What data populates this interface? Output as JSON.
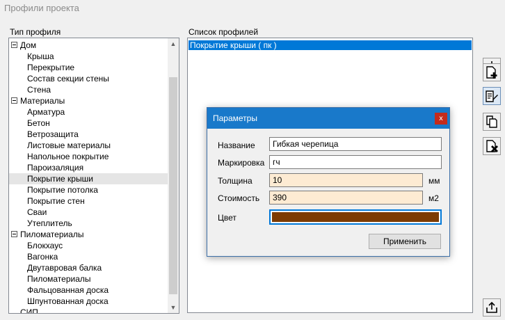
{
  "window": {
    "title": "Профили проекта"
  },
  "tree": {
    "label": "Тип профиля",
    "rows": [
      {
        "text": "Дом",
        "level": 0,
        "expandable": true
      },
      {
        "text": "Крыша",
        "level": 1
      },
      {
        "text": "Перекрытие",
        "level": 1
      },
      {
        "text": "Состав секции стены",
        "level": 1
      },
      {
        "text": "Стена",
        "level": 1
      },
      {
        "text": "Материалы",
        "level": 0,
        "expandable": true
      },
      {
        "text": "Арматура",
        "level": 1
      },
      {
        "text": "Бетон",
        "level": 1
      },
      {
        "text": "Ветрозащита",
        "level": 1
      },
      {
        "text": "Листовые материалы",
        "level": 1
      },
      {
        "text": "Напольное покрытие",
        "level": 1
      },
      {
        "text": "Пароизаляция",
        "level": 1
      },
      {
        "text": "Покрытие крыши",
        "level": 1,
        "selected": true
      },
      {
        "text": "Покрытие потолка",
        "level": 1
      },
      {
        "text": "Покрытие стен",
        "level": 1
      },
      {
        "text": "Сваи",
        "level": 1
      },
      {
        "text": "Утеплитель",
        "level": 1
      },
      {
        "text": "Пиломатериалы",
        "level": 0,
        "expandable": true
      },
      {
        "text": "Блокхаус",
        "level": 1
      },
      {
        "text": "Вагонка",
        "level": 1
      },
      {
        "text": "Двутавровая балка",
        "level": 1
      },
      {
        "text": "Пиломатериалы",
        "level": 1
      },
      {
        "text": "Фальцованная доска",
        "level": 1
      },
      {
        "text": "Шпунтованная доска",
        "level": 1
      },
      {
        "text": "СИП",
        "level": 0
      }
    ]
  },
  "profiles": {
    "label": "Список профилей",
    "items": [
      "Покрытие крыши ( пк )"
    ]
  },
  "dialog": {
    "title": "Параметры",
    "close_glyph": "x",
    "fields": {
      "name": {
        "label": "Название",
        "value": "Гибкая черепица"
      },
      "mark": {
        "label": "Маркировка",
        "value": "гч"
      },
      "thickness": {
        "label": "Толщина",
        "value": "10",
        "unit": "мм"
      },
      "cost": {
        "label": "Стоимость",
        "value": "390",
        "unit": "м2"
      },
      "color": {
        "label": "Цвет",
        "value": "#7d3b02"
      }
    },
    "apply_label": "Применить"
  },
  "toolbar": {
    "icons": [
      "import-icon",
      "new-profile-icon",
      "edit-profile-icon",
      "copy-profile-icon",
      "delete-profile-icon",
      "export-icon"
    ]
  },
  "colors": {
    "selection": "#0078d7",
    "dialog_titlebar": "#1979ca",
    "close_button": "#c42b1c",
    "numeric_field": "#fdebd3"
  }
}
